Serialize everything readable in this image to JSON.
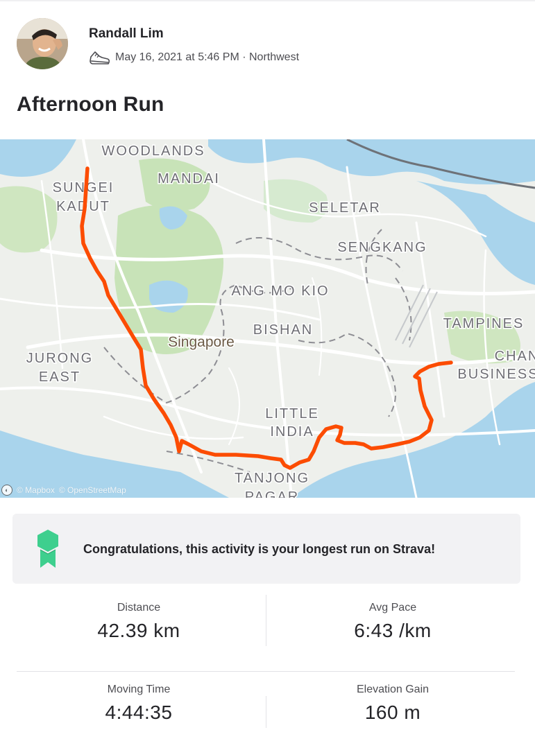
{
  "athlete": {
    "name": "Randall Lim",
    "activity_meta": "May 16, 2021 at 5:46 PM · Northwest",
    "activity_icon": "shoe-icon"
  },
  "activity": {
    "title": "Afternoon Run"
  },
  "map": {
    "place_labels": {
      "woodlands": "WOODLANDS",
      "mandai": "MANDAI",
      "sungei1": "SUNGEI",
      "sungei2": "KADUT",
      "seletar": "SELETAR",
      "sengkang": "SENGKANG",
      "angmokio": "ANG MO KIO",
      "bishan": "BISHAN",
      "singapore": "Singapore",
      "tampines": "TAMPINES",
      "jurong1": "JURONG",
      "jurong2": "EAST",
      "chan": "CHAN",
      "business": "BUSINESS",
      "little1": "LITTLE",
      "little2": "INDIA",
      "tanjong1": "TANJONG",
      "tanjong2": "PAGAR"
    },
    "route_color": "#fc4c02",
    "attribution_mapbox": "© Mapbox",
    "attribution_osm": "© OpenStreetMap"
  },
  "achievement": {
    "text": "Congratulations, this activity is your longest run on Strava!",
    "badge_color": "#3ecf8e",
    "icon": "award-badge-icon"
  },
  "stats": {
    "distance": {
      "label": "Distance",
      "value": "42.39 km"
    },
    "avg_pace": {
      "label": "Avg Pace",
      "value": "6:43 /km"
    },
    "moving_time": {
      "label": "Moving Time",
      "value": "4:44:35"
    },
    "elevation_gain": {
      "label": "Elevation Gain",
      "value": "160 m"
    }
  }
}
